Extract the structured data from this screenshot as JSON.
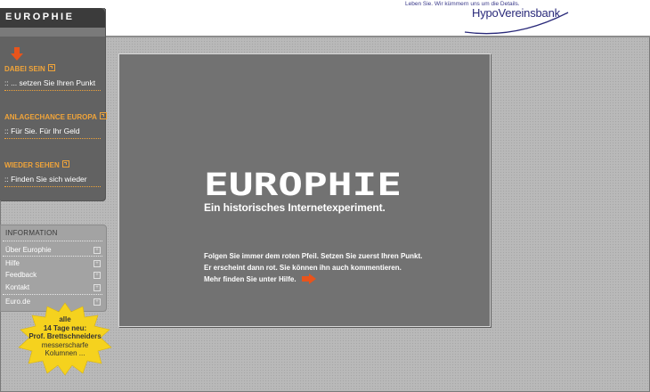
{
  "header": {
    "slogan": "Leben Sie. Wir kümmern uns um die Details.",
    "bank_name": "HypoVereinsbank"
  },
  "nav": {
    "logo": "EUROPHIE",
    "sections": [
      {
        "title": "DABEI SEIN",
        "subtitle": ":: ... setzen Sie Ihren Punkt"
      },
      {
        "title": "ANLAGECHANCE EUROPA",
        "subtitle": ":: Für Sie. Für Ihr Geld"
      },
      {
        "title": "WIEDER SEHEN",
        "subtitle": ":: Finden Sie sich wieder"
      }
    ]
  },
  "info": {
    "title": "INFORMATION",
    "items": [
      "Über Europhie",
      "Hilfe",
      "Feedback",
      "Kontakt",
      "Euro.de"
    ]
  },
  "promo": {
    "line1": "alle",
    "line2": "14 Tage neu:",
    "line3": "Prof. Brettschneiders",
    "line4": "messerscharfe",
    "line5": "Kolumnen ..."
  },
  "main": {
    "title": "EUROPHIE",
    "tagline": "Ein historisches Internetexperiment.",
    "intro_lines": [
      "Folgen Sie immer dem roten Pfeil. Setzen Sie zuerst Ihren Punkt.",
      "Er erscheint dann rot. Sie können  ihn auch kommentieren.",
      "Mehr finden Sie unter Hilfe."
    ]
  },
  "colors": {
    "accent": "#f0a43a",
    "arrow": "#e8541c",
    "panel": "#727272",
    "nav": "#626262",
    "bank": "#2a2a7a",
    "star": "#f5d21e"
  },
  "icons": [
    "red-arrow-down-icon",
    "external-link-icon",
    "plus-box-icon",
    "red-arrow-right-icon",
    "starburst-icon"
  ]
}
